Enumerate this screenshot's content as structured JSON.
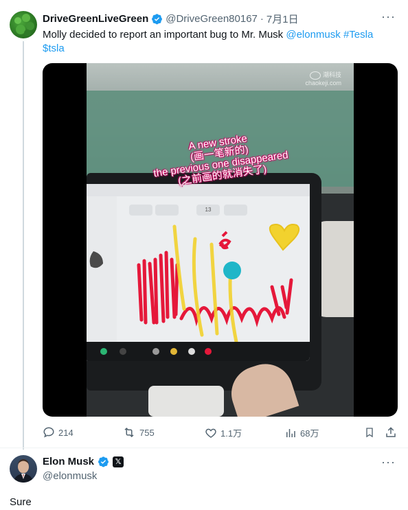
{
  "tweet": {
    "author_name": "DriveGreenLiveGreen",
    "handle": "@DriveGreen80167",
    "separator": "·",
    "date": "7月1日",
    "text_plain": "Molly decided to report an important bug to Mr. Musk ",
    "mention": "@elonmusk",
    "hashtag": "#Tesla",
    "cashtag": "$tsla",
    "more_label": "···",
    "media": {
      "overlay_lines": [
        "A new stroke",
        "(画一笔新的)",
        "the previous one disappeared",
        "(之前画的就消失了)"
      ],
      "screen_fan_value": "13",
      "watermark_line1": "潮科技",
      "watermark_line2": "chaokeji.com"
    },
    "actions": {
      "reply_count": "214",
      "retweet_count": "755",
      "like_count": "1.1万",
      "views_count": "68万"
    }
  },
  "reply": {
    "author_name": "Elon Musk",
    "handle": "@elonmusk",
    "x_badge": "𝕏",
    "more_label": "···",
    "text": "Sure"
  },
  "colors": {
    "link": "#1d9bf0",
    "verified": "#1d9bf0",
    "muted": "#536471",
    "drawing_red": "#e5183a",
    "drawing_yellow": "#f2d22e",
    "drawing_cyan": "#1fb6c8",
    "overlay_pink": "#d4146b"
  }
}
